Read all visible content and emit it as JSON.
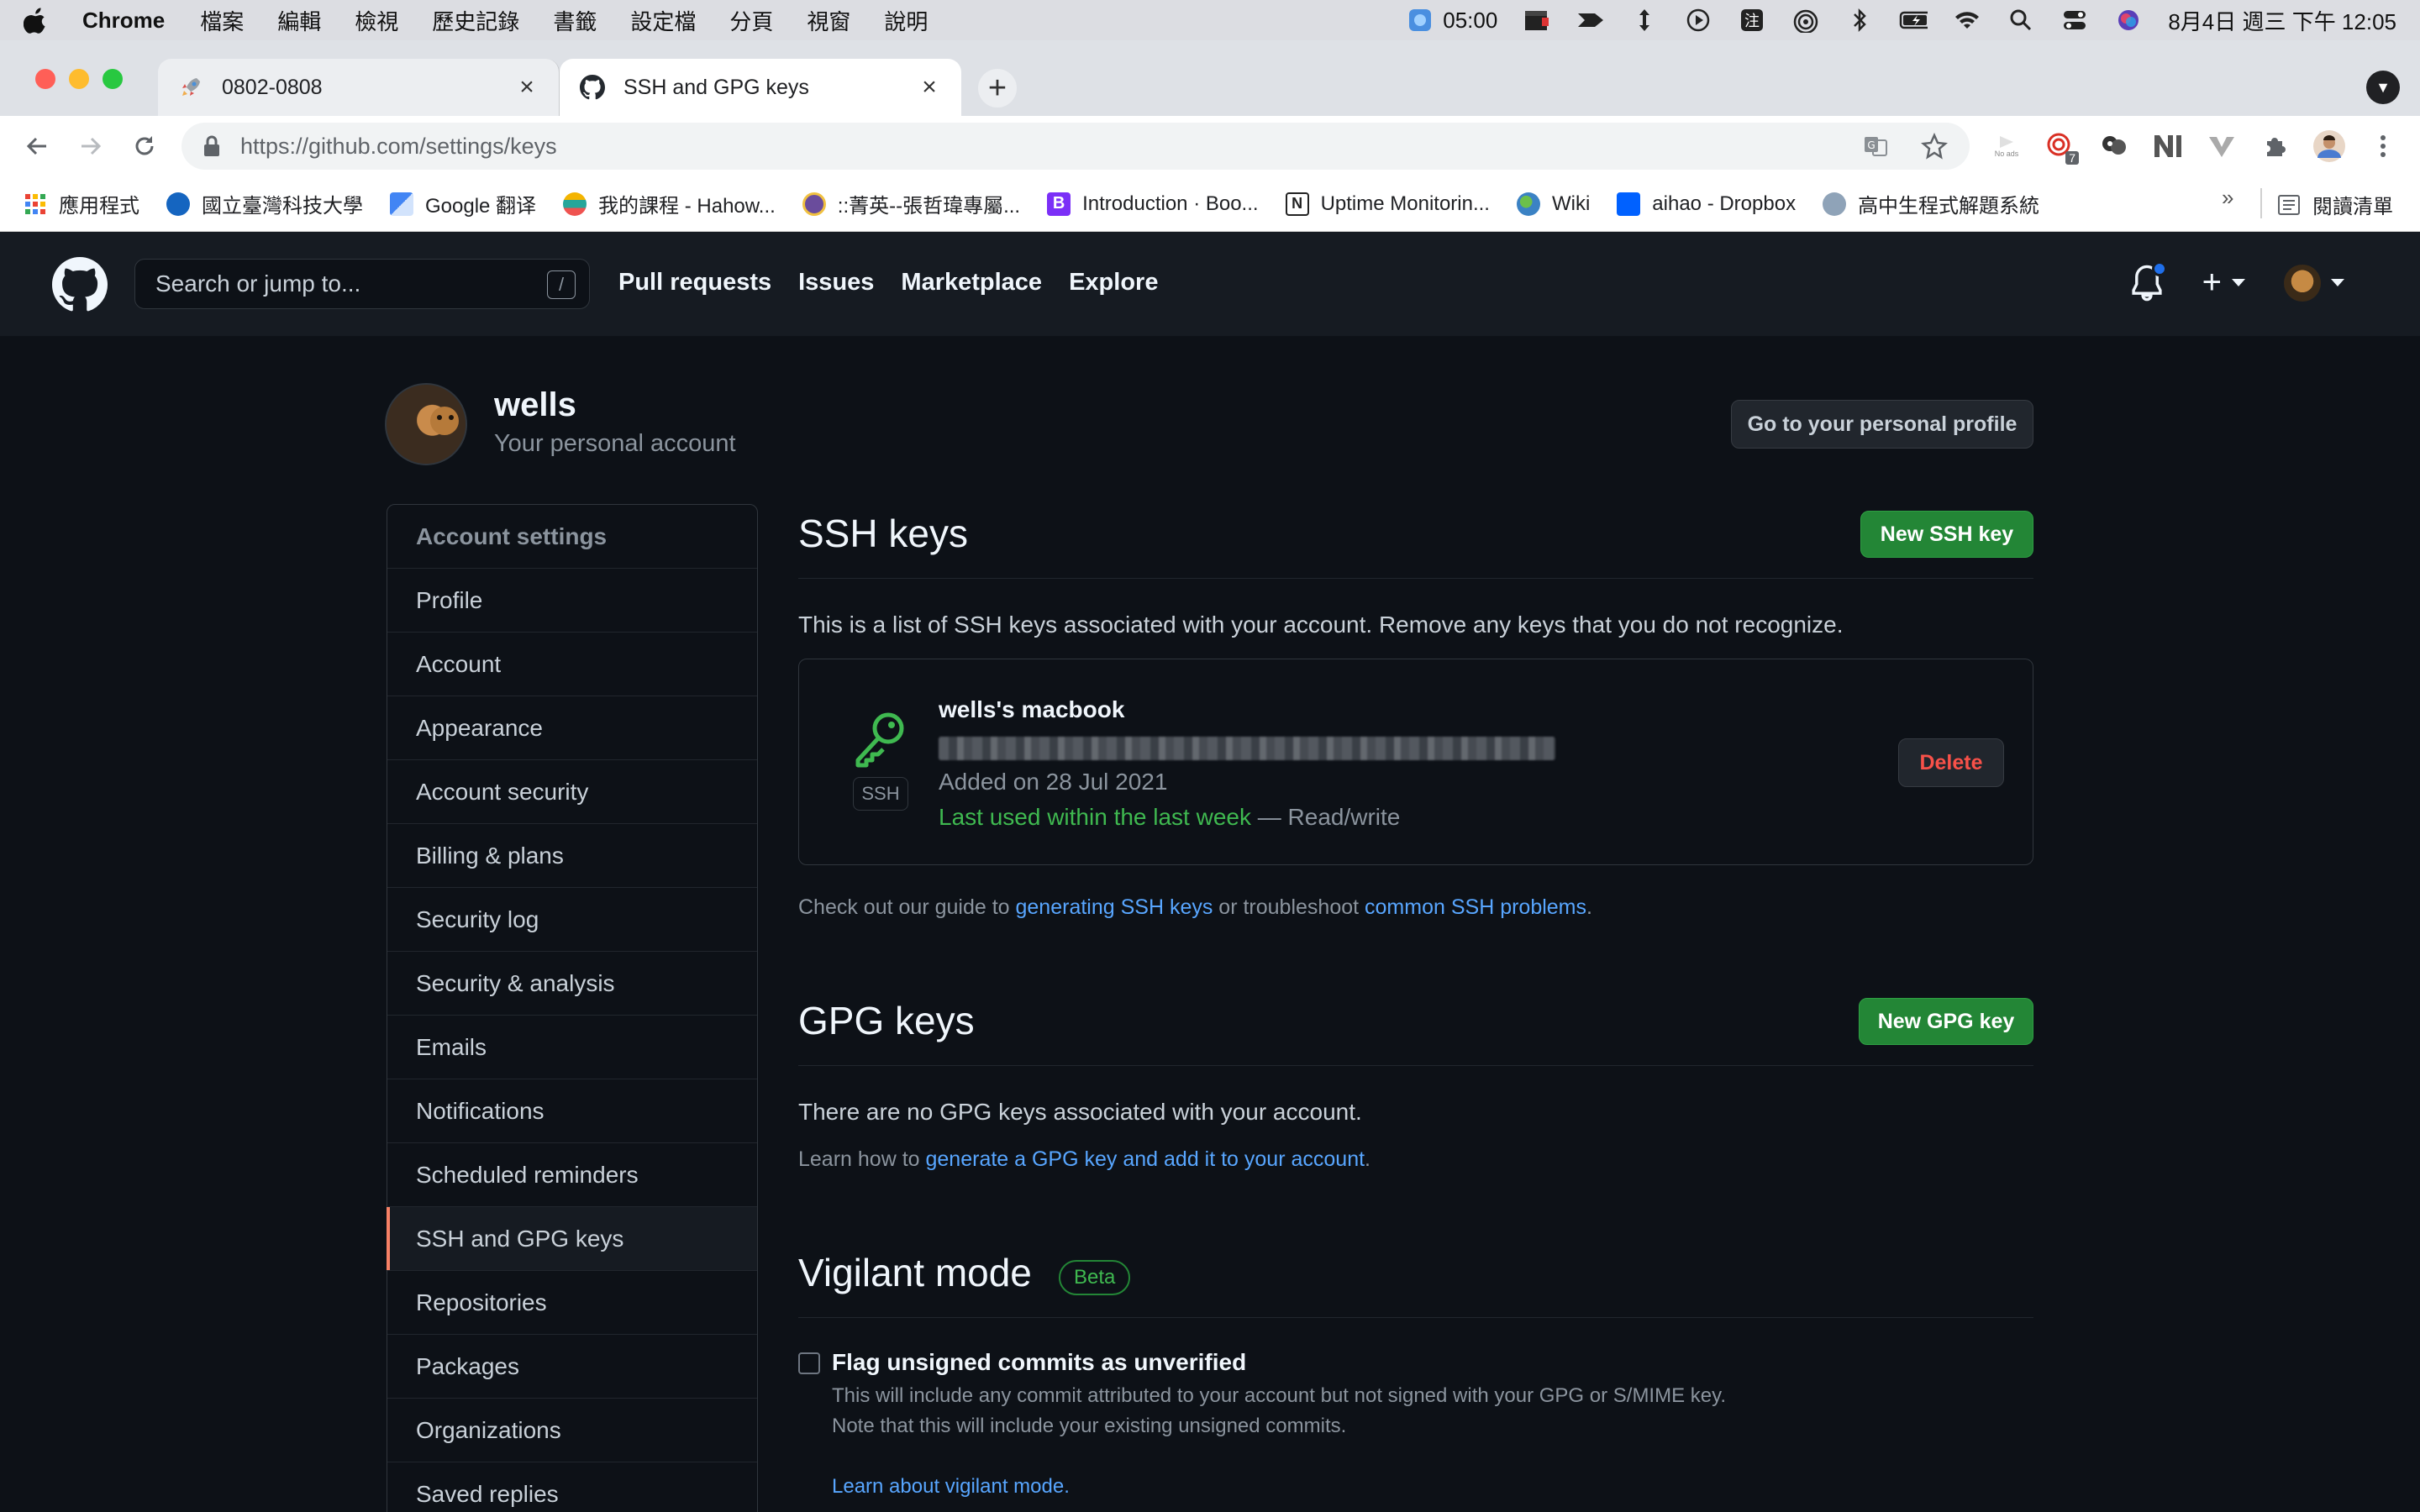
{
  "menubar": {
    "app": "Chrome",
    "items": [
      "檔案",
      "編輯",
      "檢視",
      "歷史記錄",
      "書籤",
      "設定檔",
      "分頁",
      "視窗",
      "說明"
    ],
    "timer": "05:00",
    "clock": "8月4日 週三 下午 12:05"
  },
  "browser": {
    "tabs": [
      {
        "title": "0802-0808",
        "active": false
      },
      {
        "title": "SSH and GPG keys",
        "active": true
      }
    ],
    "url": "https://github.com/settings/keys",
    "bookmarks": [
      {
        "label": "應用程式",
        "color": "#4285f4"
      },
      {
        "label": "國立臺灣科技大學",
        "color": "#1565c0"
      },
      {
        "label": "Google 翻译",
        "color": "#4285f4"
      },
      {
        "label": "我的課程 - Hahow...",
        "color": "#26a69a"
      },
      {
        "label": "::菁英--張哲瑋專屬...",
        "color": "#6a4c9c"
      },
      {
        "label": "Introduction · Boo...",
        "color": "#7b2ff7"
      },
      {
        "label": "Uptime Monitorin...",
        "color": "#222222"
      },
      {
        "label": "Wiki",
        "color": "#3b82c4"
      },
      {
        "label": "aihao - Dropbox",
        "color": "#0061ff"
      },
      {
        "label": "高中生程式解題系統",
        "color": "#8fa3b8"
      }
    ],
    "bookmarks_more": "»",
    "reading_list": "閱讀清單",
    "ext_badge": "7",
    "ext_noads": "No ads"
  },
  "github": {
    "search_placeholder": "Search or jump to...",
    "search_key": "/",
    "nav": [
      "Pull requests",
      "Issues",
      "Marketplace",
      "Explore"
    ],
    "user": "wells",
    "account_subtitle": "Your personal account",
    "profile_button": "Go to your personal profile",
    "sidebar": {
      "header": "Account settings",
      "items": [
        "Profile",
        "Account",
        "Appearance",
        "Account security",
        "Billing & plans",
        "Security log",
        "Security & analysis",
        "Emails",
        "Notifications",
        "Scheduled reminders",
        "SSH and GPG keys",
        "Repositories",
        "Packages",
        "Organizations",
        "Saved replies"
      ],
      "selected": "SSH and GPG keys"
    },
    "ssh": {
      "title": "SSH keys",
      "new_button": "New SSH key",
      "description": "This is a list of SSH keys associated with your account. Remove any keys that you do not recognize.",
      "key": {
        "title": "wells's macbook",
        "badge": "SSH",
        "added": "Added on 28 Jul 2021",
        "last_used": "Last used within the last week",
        "access": " — Read/write",
        "delete": "Delete"
      },
      "guide_prefix": "Check out our guide to ",
      "guide_link1": "generating SSH keys",
      "guide_mid": " or troubleshoot ",
      "guide_link2": "common SSH problems",
      "guide_suffix": "."
    },
    "gpg": {
      "title": "GPG keys",
      "new_button": "New GPG key",
      "empty": "There are no GPG keys associated with your account.",
      "learn_prefix": "Learn how to ",
      "learn_link": "generate a GPG key and add it to your account",
      "learn_suffix": "."
    },
    "vigilant": {
      "title": "Vigilant mode",
      "badge": "Beta",
      "checkbox_label": "Flag unsigned commits as unverified",
      "note1": "This will include any commit attributed to your account but not signed with your GPG or S/MIME key.",
      "note2": "Note that this will include your existing unsigned commits.",
      "link": "Learn about vigilant mode."
    }
  },
  "colors": {
    "bg": "#0d1117",
    "header_bg": "#161b22",
    "green_button": "#238636",
    "link": "#58a6ff",
    "danger": "#f85149",
    "selected_accent": "#f78166"
  }
}
